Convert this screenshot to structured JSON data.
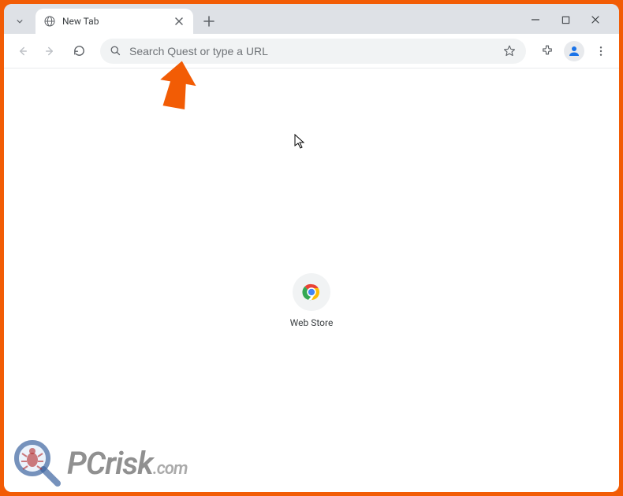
{
  "tab": {
    "title": "New Tab"
  },
  "omnibox": {
    "placeholder": "Search Quest or type a URL"
  },
  "shortcuts": [
    {
      "label": "Web Store"
    }
  ],
  "watermark": {
    "text_main": "PCrisk",
    "text_suffix": ".com"
  }
}
